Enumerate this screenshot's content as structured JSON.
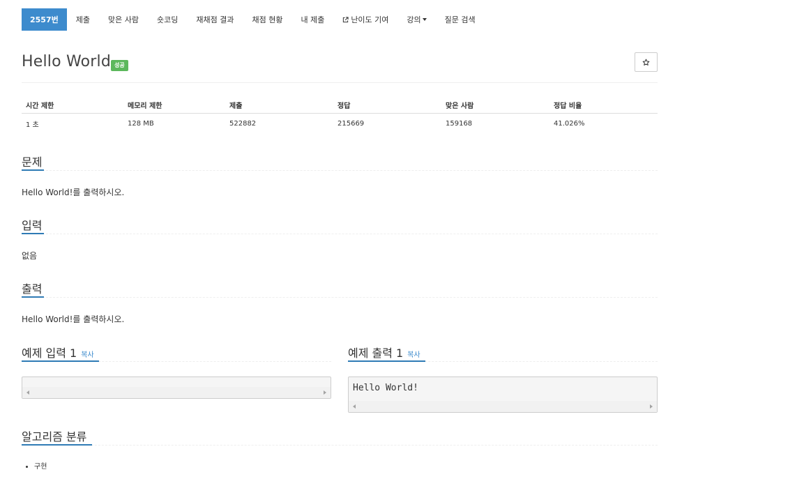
{
  "nav": {
    "items": [
      {
        "label": "2557번",
        "active": true
      },
      {
        "label": "제출"
      },
      {
        "label": "맞은 사람"
      },
      {
        "label": "숏코딩"
      },
      {
        "label": "재채점 결과"
      },
      {
        "label": "채점 현황"
      },
      {
        "label": "내 제출"
      },
      {
        "label": "난이도 기여",
        "icon": "external-link-icon"
      },
      {
        "label": "강의",
        "dropdown": true
      },
      {
        "label": "질문 검색"
      }
    ]
  },
  "problem": {
    "title": "Hello World",
    "status_badge": "성공",
    "star_icon": "star-outline-icon"
  },
  "info_table": {
    "headers": [
      "시간 제한",
      "메모리 제한",
      "제출",
      "정답",
      "맞은 사람",
      "정답 비율"
    ],
    "row": [
      "1 초",
      "128 MB",
      "522882",
      "215669",
      "159168",
      "41.026%"
    ]
  },
  "sections": {
    "problem": {
      "heading": "문제",
      "text": "Hello World!를 출력하시오."
    },
    "input": {
      "heading": "입력",
      "text": "없음"
    },
    "output": {
      "heading": "출력",
      "text": "Hello World!를 출력하시오."
    }
  },
  "sample_input": {
    "heading": "예제 입력 1",
    "copy_label": "복사",
    "content": ""
  },
  "sample_output": {
    "heading": "예제 출력 1",
    "copy_label": "복사",
    "content": "Hello World!"
  },
  "algorithm": {
    "heading": "알고리즘 분류",
    "tags": [
      "구현"
    ]
  },
  "colors": {
    "accent": "#3d8bcd",
    "success": "#5cb85c",
    "underline": "#2f7bb5"
  }
}
